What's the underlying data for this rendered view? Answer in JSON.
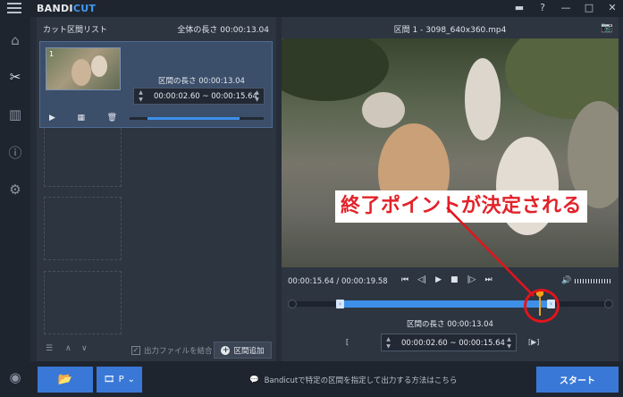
{
  "app": {
    "brand_prefix": "BANDI",
    "brand_suffix": "CUT"
  },
  "titlebar_icons": [
    "folder-icon",
    "help-icon",
    "minimize-icon",
    "maximize-icon",
    "close-icon"
  ],
  "titlebar": {
    "folder": "▬",
    "help": "?",
    "minimize": "—",
    "maximize": "□",
    "close": "✕"
  },
  "sidebar": {
    "items": [
      {
        "name": "home",
        "glyph": "⌂"
      },
      {
        "name": "cut",
        "glyph": "✂"
      },
      {
        "name": "join",
        "glyph": "▥"
      },
      {
        "name": "info",
        "glyph": "ⓘ"
      },
      {
        "name": "settings",
        "glyph": "⚙"
      }
    ],
    "record_glyph": "◉"
  },
  "left_panel": {
    "title": "カット区間リスト",
    "total_length": "全体の長さ 00:00:13.04",
    "clip": {
      "number": "1",
      "segment_length": "区間の長さ 00:00:13.04",
      "time_range": "00:00:02.60 ~ 00:00:15.64",
      "play_glyph": "▶",
      "grid_glyph": "▦",
      "trash_glyph": "🗑"
    },
    "footer": {
      "list_glyph": "☰",
      "up_glyph": "∧",
      "down_glyph": "∨",
      "merge_label": "出力ファイルを結合",
      "merge_check": "✓",
      "add_label": "区間追加",
      "add_glyph": "+"
    }
  },
  "right_panel": {
    "title": "区間 1 - 3098_640x360.mp4",
    "camera_glyph": "📷",
    "overlay_caption": "終了ポイントが決定される",
    "current_time": "00:00:15.64 / 00:00:19.58",
    "playback": [
      "⏮",
      "◁|",
      "▶",
      "■",
      "|▷",
      "⏭"
    ],
    "volume_glyph": "🔊",
    "segment_length": "区間の長さ 00:00:13.04",
    "time_range": "00:00:02.60 ~ 00:00:15.64",
    "left_bracket": "[",
    "right_bracket": "[▶]",
    "handle_glyph": "‹"
  },
  "bottom": {
    "open_glyph": "📂",
    "format_label": "P",
    "format_glyph": "🎞",
    "tip_glyph": "💬",
    "tip": "Bandicutで特定の区間を指定して出力する方法はこちら",
    "start_label": "スタート"
  },
  "colors": {
    "accent": "#3978d6",
    "timeline": "#3d8fe8",
    "marker": "#f2a41a",
    "annotation": "#e3141c"
  }
}
